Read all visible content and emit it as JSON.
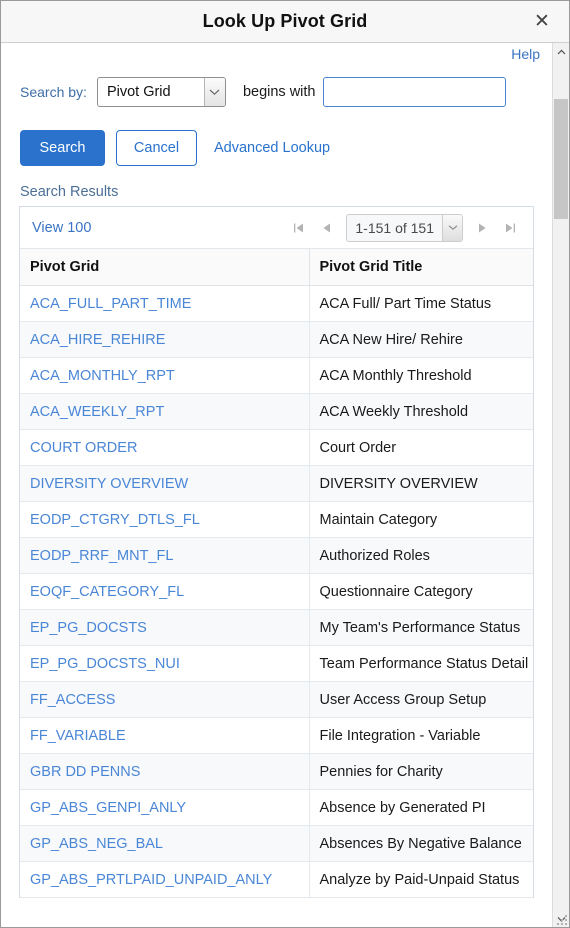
{
  "dialog": {
    "title": "Look Up Pivot Grid",
    "close_icon": "close-icon"
  },
  "help": {
    "label": "Help"
  },
  "search": {
    "search_by_label": "Search by:",
    "search_by_value": "Pivot Grid",
    "operator_label": "begins with",
    "input_value": "",
    "input_placeholder": ""
  },
  "actions": {
    "search_label": "Search",
    "cancel_label": "Cancel",
    "advanced_lookup_label": "Advanced Lookup"
  },
  "results": {
    "caption": "Search Results",
    "view_all_label": "View 100",
    "pager": {
      "range_text": "1-151 of 151",
      "first_icon": "first-page-icon",
      "prev_icon": "previous-page-icon",
      "next_icon": "next-page-icon",
      "last_icon": "last-page-icon",
      "dropdown_icon": "chevron-down-icon"
    },
    "columns": [
      "Pivot Grid",
      "Pivot Grid Title"
    ],
    "rows": [
      {
        "name": "ACA_FULL_PART_TIME",
        "title": "ACA Full/ Part Time Status"
      },
      {
        "name": "ACA_HIRE_REHIRE",
        "title": "ACA New Hire/ Rehire"
      },
      {
        "name": "ACA_MONTHLY_RPT",
        "title": "ACA Monthly Threshold"
      },
      {
        "name": "ACA_WEEKLY_RPT",
        "title": "ACA Weekly Threshold"
      },
      {
        "name": "COURT ORDER",
        "title": "Court Order"
      },
      {
        "name": "DIVERSITY OVERVIEW",
        "title": "DIVERSITY OVERVIEW"
      },
      {
        "name": "EODP_CTGRY_DTLS_FL",
        "title": "Maintain Category"
      },
      {
        "name": "EODP_RRF_MNT_FL",
        "title": "Authorized Roles"
      },
      {
        "name": "EOQF_CATEGORY_FL",
        "title": "Questionnaire Category"
      },
      {
        "name": "EP_PG_DOCSTS",
        "title": "My Team's Performance Status"
      },
      {
        "name": "EP_PG_DOCSTS_NUI",
        "title": "Team Performance Status Detail"
      },
      {
        "name": "FF_ACCESS",
        "title": "User Access Group Setup"
      },
      {
        "name": "FF_VARIABLE",
        "title": "File Integration - Variable"
      },
      {
        "name": "GBR DD PENNS",
        "title": "Pennies for Charity"
      },
      {
        "name": "GP_ABS_GENPI_ANLY",
        "title": "Absence by Generated PI"
      },
      {
        "name": "GP_ABS_NEG_BAL",
        "title": "Absences By Negative Balance"
      },
      {
        "name": "GP_ABS_PRTLPAID_UNPAID_ANLY",
        "title": "Analyze by Paid-Unpaid Status"
      }
    ]
  },
  "scrollbar": {
    "up_icon": "scroll-up-icon",
    "down_icon": "scroll-down-icon"
  },
  "colors": {
    "primary": "#2a72cc",
    "link": "#4a86d6",
    "header_bg": "#f7f7f7"
  }
}
